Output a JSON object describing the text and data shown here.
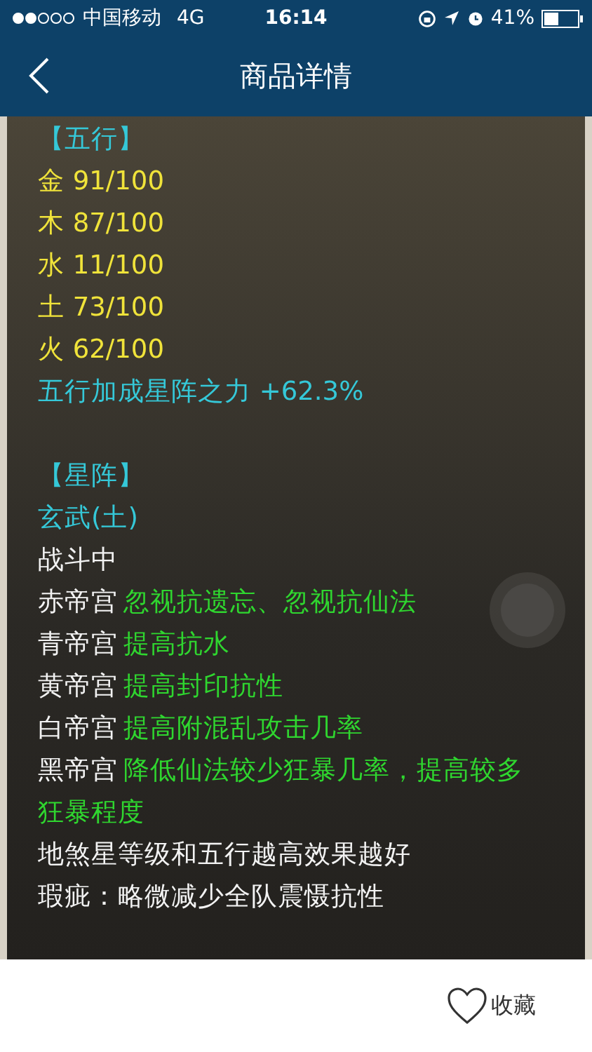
{
  "status_bar": {
    "carrier": "中国移动",
    "network": "4G",
    "time": "16:14",
    "battery": "41%"
  },
  "nav": {
    "title": "商品详情"
  },
  "sections": [
    {
      "heading": "【五行】",
      "lines": [
        {
          "kind": "stat",
          "text": "金 91/100"
        },
        {
          "kind": "stat",
          "text": "木 87/100"
        },
        {
          "kind": "stat",
          "text": "水 11/100"
        },
        {
          "kind": "stat",
          "text": "土 73/100"
        },
        {
          "kind": "stat",
          "text": "火 62/100"
        },
        {
          "kind": "bonus",
          "text": "五行加成星阵之力 +62.3%"
        }
      ]
    },
    {
      "heading": "【星阵】",
      "lines": [
        {
          "kind": "bonus",
          "text": "玄武(土)"
        },
        {
          "kind": "text",
          "text": "战斗中"
        },
        {
          "kind": "effect",
          "label": "赤帝宫",
          "text": "忽视抗遗忘、忽视抗仙法"
        },
        {
          "kind": "effect",
          "label": "青帝宫",
          "text": "提高抗水"
        },
        {
          "kind": "effect",
          "label": "黄帝宫",
          "text": "提高封印抗性"
        },
        {
          "kind": "effect",
          "label": "白帝宫",
          "text": "提高附混乱攻击几率"
        },
        {
          "kind": "effect",
          "label": "黑帝宫",
          "text": "降低仙法较少狂暴几率，提高较多狂暴程度"
        },
        {
          "kind": "text",
          "text": "地煞星等级和五行越高效果越好"
        },
        {
          "kind": "text",
          "text": "瑕疵：略微减少全队震慑抗性"
        }
      ]
    }
  ],
  "bottom_bar": {
    "favorite": "收藏"
  }
}
